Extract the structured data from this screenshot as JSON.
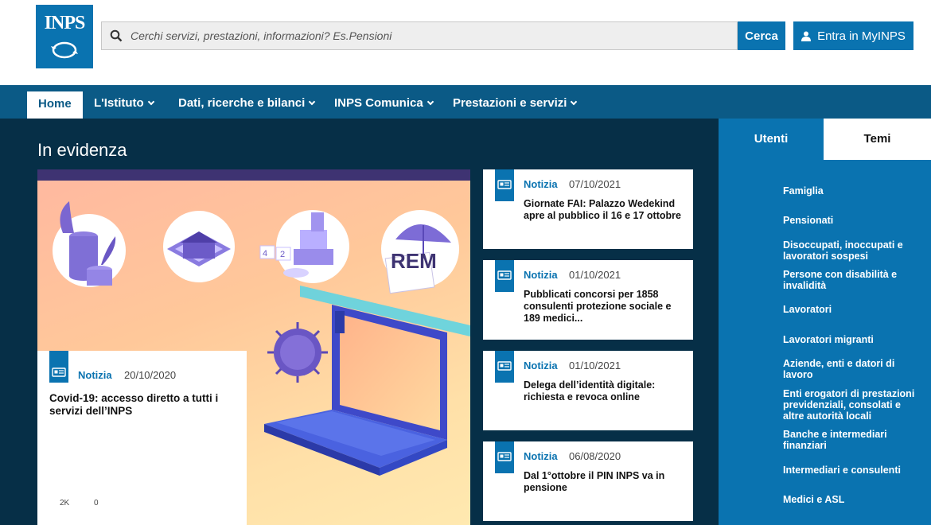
{
  "header": {
    "logo_text": "INPS",
    "search_placeholder": "Cerchi servizi, prestazioni, informazioni? Es.Pensioni",
    "search_button": "Cerca",
    "login_button": "Entra in MyINPS"
  },
  "nav": {
    "items": [
      {
        "label": "Home"
      },
      {
        "label": "L'Istituto"
      },
      {
        "label": "Dati, ricerche e bilanci"
      },
      {
        "label": "INPS Comunica"
      },
      {
        "label": "Prestazioni e servizi"
      }
    ]
  },
  "main": {
    "title": "In evidenza",
    "hero": {
      "tag": "Notizia",
      "date": "20/10/2020",
      "title": "Covid-19: accesso diretto a tutti i servizi dell’INPS",
      "likes": "2K",
      "comments": "0",
      "illustration_text": "REM"
    },
    "news": [
      {
        "tag": "Notizia",
        "date": "07/10/2021",
        "title": "Giornate FAI: Palazzo Wedekind apre al pubblico il 16 e 17 ottobre"
      },
      {
        "tag": "Notizia",
        "date": "01/10/2021",
        "title": "Pubblicati concorsi per 1858 consulenti protezione sociale e 189 medici..."
      },
      {
        "tag": "Notizia",
        "date": "01/10/2021",
        "title": "Delega dell’identità digitale: richiesta e revoca online"
      },
      {
        "tag": "Notizia",
        "date": "06/08/2020",
        "title": "Dal 1°ottobre il PIN INPS va in pensione"
      }
    ]
  },
  "sidebar": {
    "tabs": [
      {
        "label": "Utenti"
      },
      {
        "label": "Temi"
      }
    ],
    "links": [
      {
        "label": "Famiglia"
      },
      {
        "label": "Pensionati"
      },
      {
        "label": "Disoccupati, inoccupati e lavoratori sospesi"
      },
      {
        "label": "Persone con disabilità e invalidità"
      },
      {
        "label": "Lavoratori"
      },
      {
        "label": "Lavoratori migranti"
      },
      {
        "label": "Aziende, enti e datori di lavoro"
      },
      {
        "label": "Enti erogatori di prestazioni previdenziali, consolati e altre autorità locali"
      },
      {
        "label": "Banche e intermediari finanziari"
      },
      {
        "label": "Intermediari e consulenti"
      },
      {
        "label": "Medici e ASL"
      }
    ]
  },
  "colors": {
    "brand_blue": "#0a73b0",
    "nav_blue": "#0b5a86",
    "main_dark": "#062f47"
  }
}
